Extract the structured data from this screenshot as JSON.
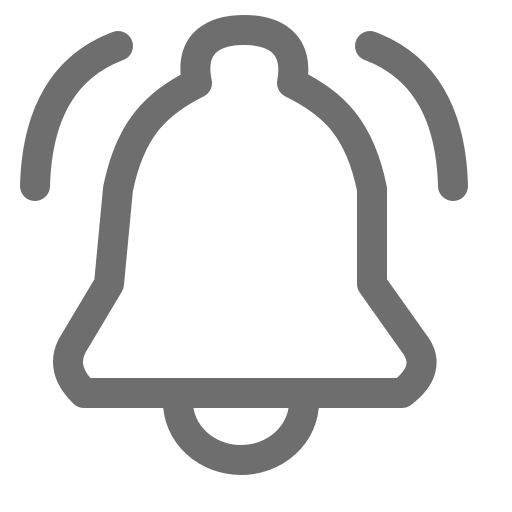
{
  "icon": {
    "name": "bell-ringing-icon",
    "stroke_color": "#6e6e6e",
    "background": "#ffffff"
  }
}
